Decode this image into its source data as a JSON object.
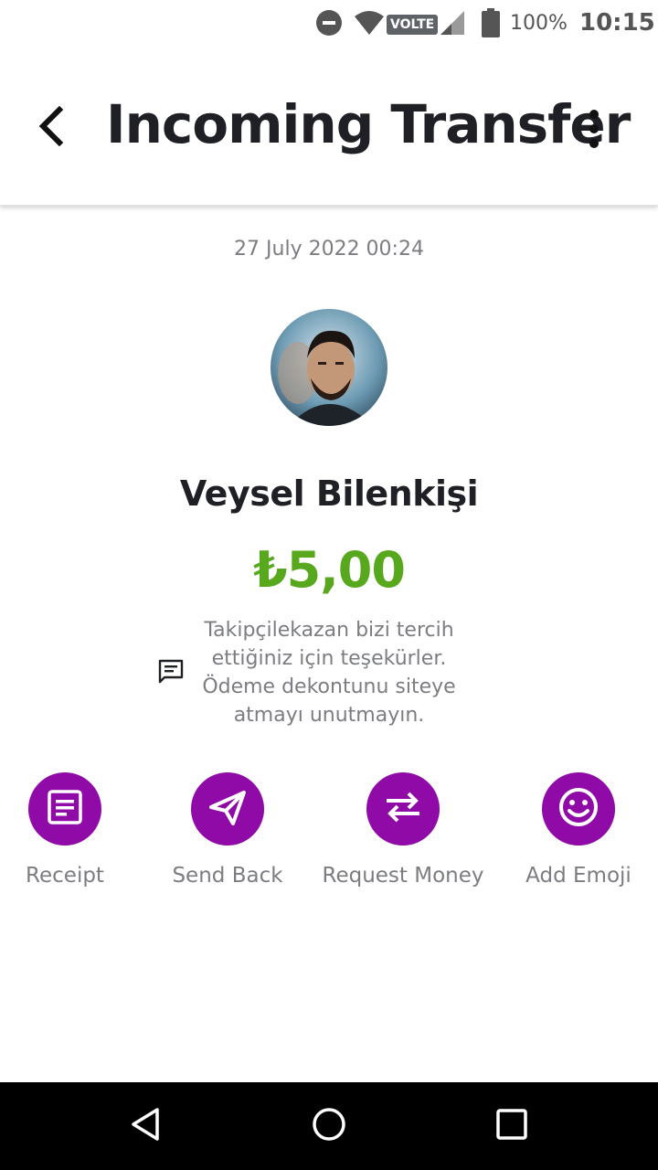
{
  "status_bar": {
    "volte": "VOLTE",
    "battery_percent": "100%",
    "time": "10:15",
    "icons": [
      "do-not-disturb-icon",
      "wifi-icon",
      "signal-icon",
      "battery-icon"
    ]
  },
  "header": {
    "title": "Incoming Transfer",
    "back_icon": "back-chevron-icon",
    "menu_icon": "more-vert-icon"
  },
  "transfer": {
    "date": "27 July 2022 00:24",
    "sender_name": "Veysel Bilenkişi",
    "amount": "₺5,00",
    "message": "Takipçilekazan bizi tercih ettiğiniz için teşekürler. Ödeme dekontunu siteye atmayı unutmayın."
  },
  "actions": [
    {
      "label": "Receipt",
      "icon": "receipt-icon"
    },
    {
      "label": "Send Back",
      "icon": "send-icon"
    },
    {
      "label": "Request Money",
      "icon": "swap-arrows-icon"
    },
    {
      "label": "Add Emoji",
      "icon": "smiley-icon"
    }
  ],
  "colors": {
    "accent": "#8f0aa6",
    "amount": "#57a81c",
    "text_primary": "#1f2025",
    "text_secondary": "#7b7d83"
  }
}
